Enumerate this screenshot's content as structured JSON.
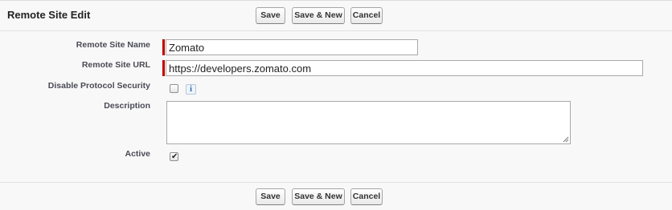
{
  "header": {
    "title": "Remote Site Edit"
  },
  "buttons": {
    "save": "Save",
    "save_new": "Save & New",
    "cancel": "Cancel"
  },
  "form": {
    "remote_site_name": {
      "label": "Remote Site Name",
      "value": "Zomato",
      "required": true
    },
    "remote_site_url": {
      "label": "Remote Site URL",
      "value": "https://developers.zomato.com",
      "required": true
    },
    "disable_protocol_security": {
      "label": "Disable Protocol Security",
      "checked": false,
      "help_icon": "info-icon"
    },
    "description": {
      "label": "Description",
      "value": ""
    },
    "active": {
      "label": "Active",
      "checked": true
    }
  },
  "colors": {
    "required_marker": "#c00000",
    "panel_background": "#f8f8f8"
  }
}
